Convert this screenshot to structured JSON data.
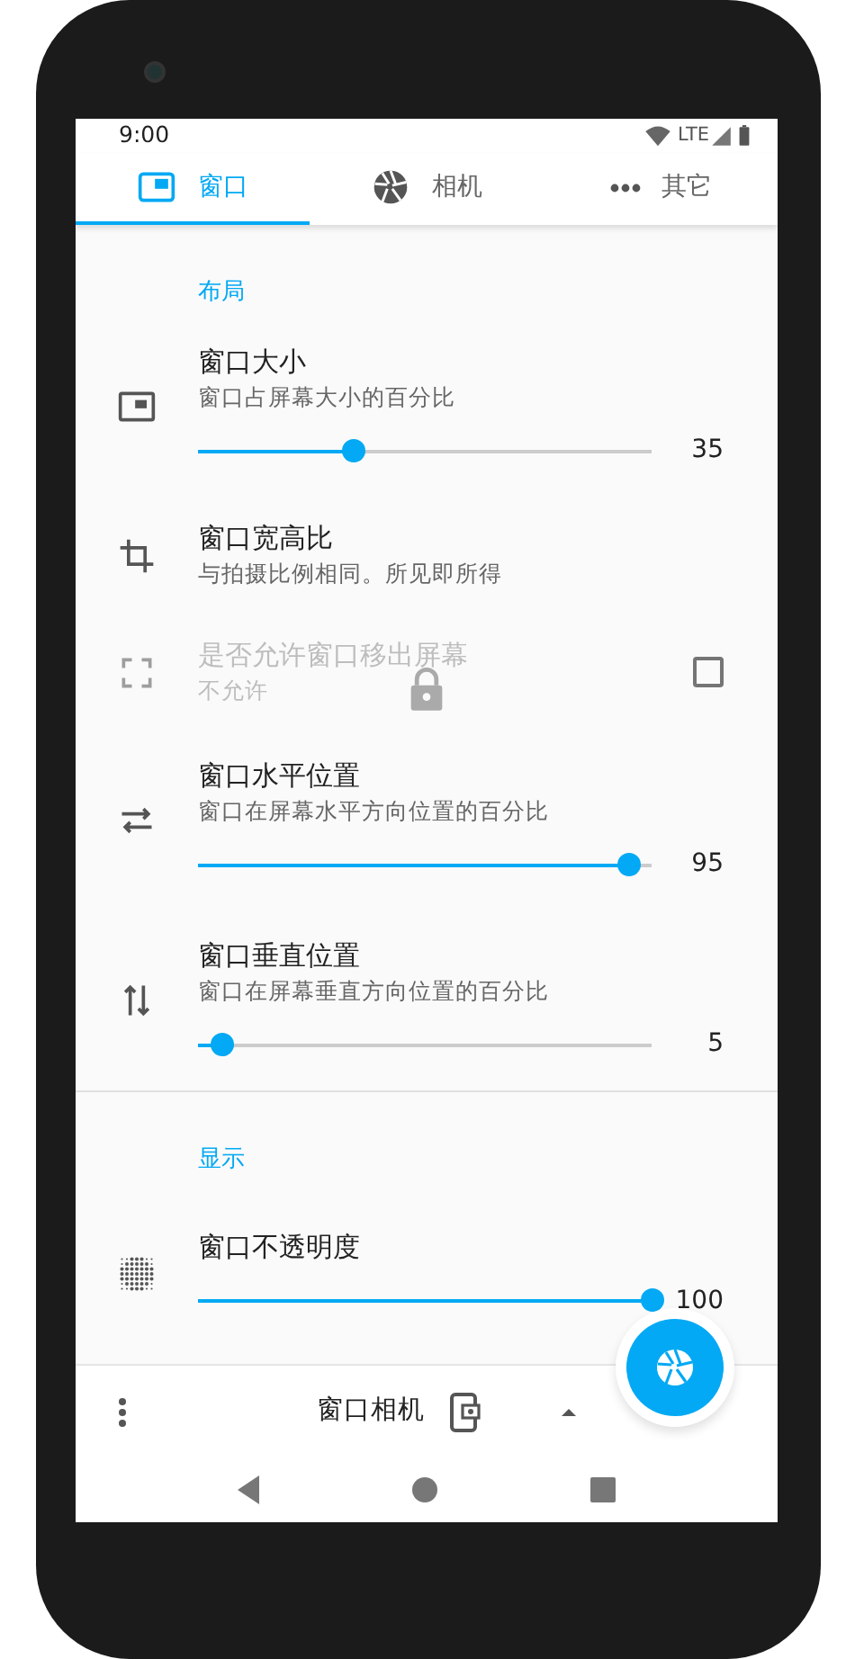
{
  "status_bar": {
    "time": "9:00",
    "network": "LTE"
  },
  "tabs": [
    {
      "label": "窗口",
      "selected": true
    },
    {
      "label": "相机",
      "selected": false
    },
    {
      "label": "其它",
      "selected": false
    }
  ],
  "sections": [
    {
      "header": "布局",
      "items": [
        {
          "kind": "slider",
          "title": "窗口大小",
          "subtitle": "窗口占屏幕大小的百分比",
          "level": 0.34,
          "value": "35"
        },
        {
          "kind": "plain",
          "title": "窗口宽高比",
          "subtitle": "与拍摄比例相同。所见即所得"
        },
        {
          "kind": "checkbox",
          "title": "是否允许窗口移出屏幕",
          "subtitle": "不允许",
          "checked": false,
          "disabled": true,
          "locked": true
        },
        {
          "kind": "slider",
          "title": "窗口水平位置",
          "subtitle": "窗口在屏幕水平方向位置的百分比",
          "level": 0.95,
          "value": "95"
        },
        {
          "kind": "slider",
          "title": "窗口垂直位置",
          "subtitle": "窗口在屏幕垂直方向位置的百分比",
          "level": 0.05,
          "value": "5"
        }
      ]
    },
    {
      "header": "显示",
      "items": [
        {
          "kind": "slider",
          "title": "窗口不透明度",
          "level": 1,
          "value": "100"
        }
      ]
    }
  ],
  "bottom_bar": {
    "title": "窗口相机"
  }
}
